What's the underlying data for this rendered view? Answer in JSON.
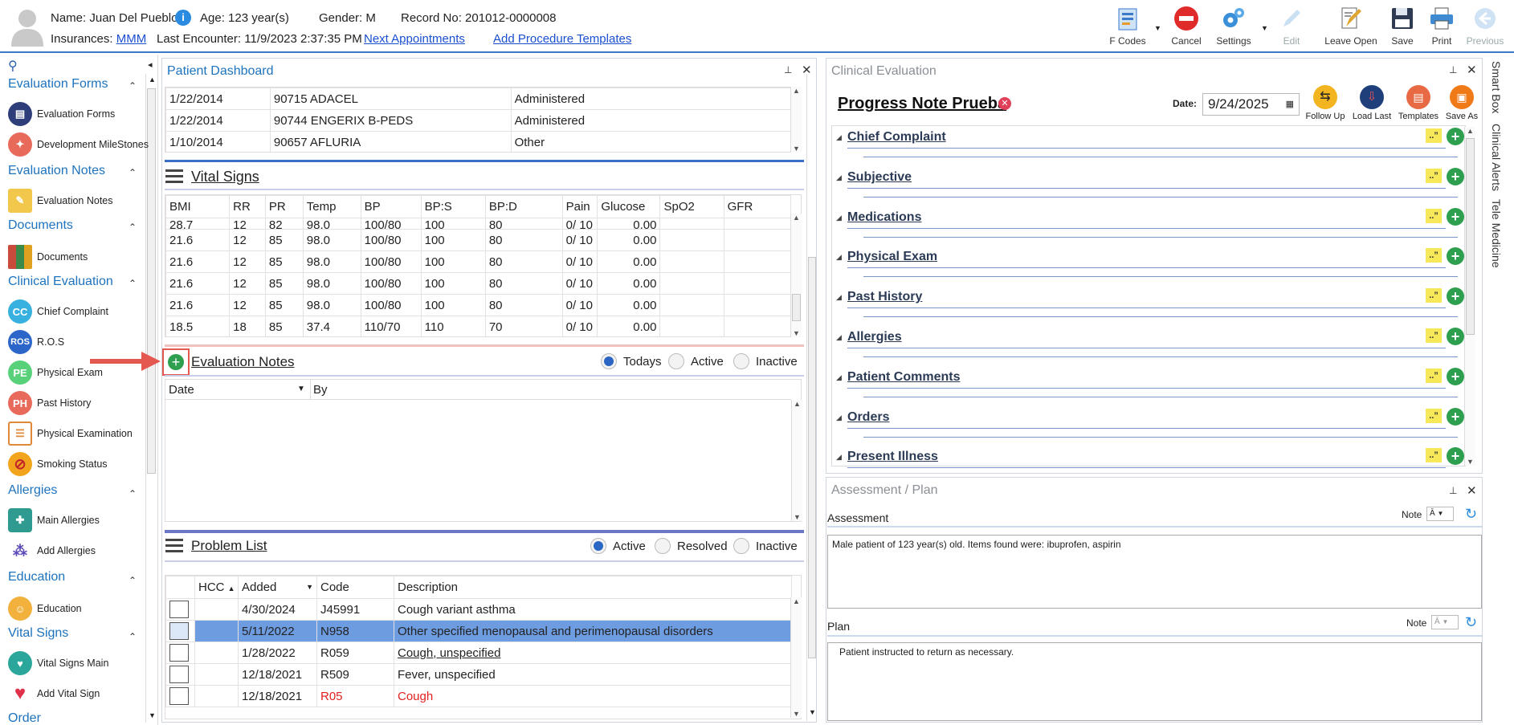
{
  "header": {
    "name_label": "Name:",
    "name": "Juan Del Pueblo",
    "age_label": "Age:",
    "age": "123 year(s)",
    "gender_label": "Gender:",
    "gender": "M",
    "record_label": "Record No:",
    "record": "201012-0000008",
    "insurances_label": "Insurances:",
    "insurance": "MMM",
    "last_encounter_label": "Last Encounter:",
    "last_encounter": "11/9/2023 2:37:35 PM",
    "next_appointments": "Next Appointments",
    "add_procedure_templates": "Add Procedure Templates"
  },
  "toolbar": {
    "fcodes": "F Codes",
    "cancel": "Cancel",
    "settings": "Settings",
    "edit": "Edit",
    "leave_open": "Leave Open",
    "save": "Save",
    "print": "Print",
    "previous": "Previous"
  },
  "sidebar": {
    "sections": [
      {
        "title": "Evaluation Forms"
      },
      {
        "title": "Evaluation Notes"
      },
      {
        "title": "Documents"
      },
      {
        "title": "Clinical Evaluation"
      },
      {
        "title": "Allergies"
      },
      {
        "title": "Education"
      },
      {
        "title": "Vital Signs"
      },
      {
        "title": "Order"
      }
    ],
    "items": [
      {
        "label": "Evaluation Forms",
        "icon": "form-icon"
      },
      {
        "label": "Development MileStones",
        "icon": "milestones-icon"
      },
      {
        "label": "Evaluation Notes",
        "icon": "notes-icon"
      },
      {
        "label": "Documents",
        "icon": "documents-icon"
      },
      {
        "label": "Chief Complaint",
        "icon": "cc-icon",
        "abbr": "CC"
      },
      {
        "label": "R.O.S",
        "icon": "ros-icon",
        "abbr": "ROS"
      },
      {
        "label": "Physical Exam",
        "icon": "pe-icon",
        "abbr": "PE"
      },
      {
        "label": "Past History",
        "icon": "ph-icon",
        "abbr": "PH"
      },
      {
        "label": "Physical Examination",
        "icon": "clipboard-icon"
      },
      {
        "label": "Smoking Status",
        "icon": "no-smoking-icon"
      },
      {
        "label": "Main Allergies",
        "icon": "allergy-kit-icon"
      },
      {
        "label": "Add Allergies",
        "icon": "add-allergy-icon"
      },
      {
        "label": "Education",
        "icon": "education-icon"
      },
      {
        "label": "Vital Signs Main",
        "icon": "heartbeat-icon"
      },
      {
        "label": "Add Vital Sign",
        "icon": "add-heart-icon"
      }
    ]
  },
  "dashboard": {
    "title": "Patient Dashboard",
    "immunizations": [
      {
        "date": "1/22/2014",
        "vaccine": "90715 ADACEL",
        "status": "Administered"
      },
      {
        "date": "1/22/2014",
        "vaccine": "90744 ENGERIX B-PEDS",
        "status": "Administered"
      },
      {
        "date": "1/10/2014",
        "vaccine": "90657 AFLURIA",
        "status": "Other"
      }
    ],
    "vitals": {
      "title": "Vital Signs",
      "columns": [
        "BMI",
        "RR",
        "PR",
        "Temp",
        "BP",
        "BP:S",
        "BP:D",
        "Pain",
        "Glucose",
        "SpO2",
        "GFR"
      ],
      "rows": [
        [
          "28.7",
          "12",
          "82",
          "98.0",
          "100/80",
          "100",
          "80",
          "0/ 10",
          "0.00",
          "",
          ""
        ],
        [
          "21.6",
          "12",
          "85",
          "98.0",
          "100/80",
          "100",
          "80",
          "0/ 10",
          "0.00",
          "",
          ""
        ],
        [
          "21.6",
          "12",
          "85",
          "98.0",
          "100/80",
          "100",
          "80",
          "0/ 10",
          "0.00",
          "",
          ""
        ],
        [
          "21.6",
          "12",
          "85",
          "98.0",
          "100/80",
          "100",
          "80",
          "0/ 10",
          "0.00",
          "",
          ""
        ],
        [
          "21.6",
          "12",
          "85",
          "98.0",
          "100/80",
          "100",
          "80",
          "0/ 10",
          "0.00",
          "",
          ""
        ],
        [
          "18.5",
          "18",
          "85",
          "37.4",
          "110/70",
          "110",
          "70",
          "0/ 10",
          "0.00",
          "",
          ""
        ]
      ]
    },
    "eval_notes": {
      "title": "Evaluation Notes",
      "filters": [
        "Todays",
        "Active",
        "Inactive"
      ],
      "selected": "Todays",
      "col_date": "Date",
      "col_by": "By"
    },
    "problems": {
      "title": "Problem List",
      "filters": [
        "Active",
        "Resolved",
        "Inactive"
      ],
      "selected": "Active",
      "columns": [
        "HCC",
        "Added",
        "Code",
        "Description"
      ],
      "rows": [
        {
          "added": "4/30/2024",
          "code": "J45991",
          "desc": "Cough variant asthma",
          "style": "normal"
        },
        {
          "added": "5/11/2022",
          "code": "N958",
          "desc": "Other specified menopausal and perimenopausal disorders",
          "style": "selected"
        },
        {
          "added": "1/28/2022",
          "code": "R059",
          "desc": "Cough, unspecified",
          "style": "underline"
        },
        {
          "added": "12/18/2021",
          "code": "R509",
          "desc": "Fever, unspecified",
          "style": "normal"
        },
        {
          "added": "12/18/2021",
          "code": "R05",
          "desc": "Cough",
          "style": "red"
        }
      ]
    }
  },
  "clinical": {
    "title": "Clinical Evaluation",
    "note_title": "Progress Note Prueba",
    "date_label": "Date:",
    "date": "9/24/2025",
    "actions": [
      "Follow Up",
      "Load Last",
      "Templates",
      "Save As"
    ],
    "sections": [
      "Chief Complaint",
      "Subjective",
      "Medications",
      "Physical Exam",
      "Past History",
      "Allergies",
      "Patient Comments",
      "Orders",
      "Present Illness"
    ]
  },
  "side_tabs": [
    "Smart Box",
    "Clinical Alerts",
    "Tele Medicine"
  ],
  "assessment": {
    "title": "Assessment / Plan",
    "assessment_label": "Assessment",
    "note_label": "Note",
    "assessment_text": "Male patient of 123 year(s) old. Items found were:  ibuprofen, aspirin",
    "plan_label": "Plan",
    "plan_text": "Patient instructed to return as necessary."
  }
}
